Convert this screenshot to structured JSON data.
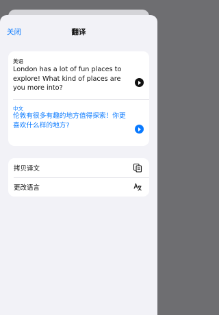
{
  "nav": {
    "close_label": "关闭",
    "title": "翻译"
  },
  "source": {
    "language": "英语",
    "text": "London has a lot of fun places to explore! What kind of places are you more into?"
  },
  "target": {
    "language": "中文",
    "text": "伦敦有很多有趣的地方值得探索！你更喜欢什么样的地方?"
  },
  "actions": [
    {
      "label": "拷贝译文",
      "icon": "copy-icon"
    },
    {
      "label": "更改语言",
      "icon": "translate-icon"
    }
  ],
  "colors": {
    "accent": "#0a7aff",
    "background": "#f2f2f7",
    "card": "#ffffff"
  }
}
